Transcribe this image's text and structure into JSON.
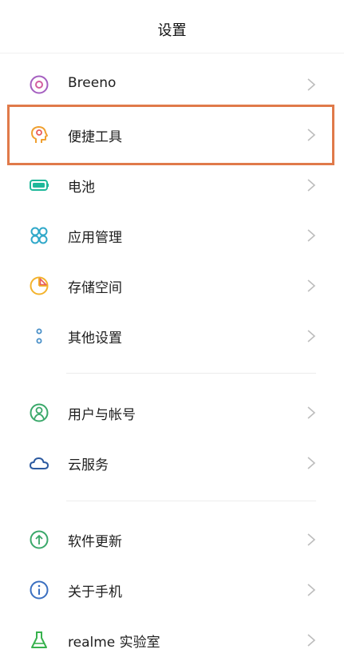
{
  "header": {
    "title": "设置"
  },
  "groups": [
    {
      "items": [
        {
          "label": "Breeno",
          "icon": "breeno-icon",
          "color": "#9b59b6"
        },
        {
          "label": "便捷工具",
          "icon": "convenience-tools-icon",
          "color": "#f0a030"
        },
        {
          "label": "电池",
          "icon": "battery-icon",
          "color": "#1fb89a"
        },
        {
          "label": "应用管理",
          "icon": "app-management-icon",
          "color": "#2fa8c9"
        },
        {
          "label": "存储空间",
          "icon": "storage-icon",
          "color": "#f3b32c"
        },
        {
          "label": "其他设置",
          "icon": "more-settings-icon",
          "color": "#4a90c8"
        }
      ]
    },
    {
      "items": [
        {
          "label": "用户与帐号",
          "icon": "user-account-icon",
          "color": "#3aa86a"
        },
        {
          "label": "云服务",
          "icon": "cloud-icon",
          "color": "#2c5aa0"
        }
      ]
    },
    {
      "items": [
        {
          "label": "软件更新",
          "icon": "software-update-icon",
          "color": "#3aa86a"
        },
        {
          "label": "关于手机",
          "icon": "about-phone-icon",
          "color": "#3a6fc0"
        },
        {
          "label": "realme 实验室",
          "icon": "lab-flask-icon",
          "color": "#37b24d"
        }
      ]
    }
  ],
  "highlight_color": "#e07a4a",
  "chevron_icon": "chevron-right-icon"
}
